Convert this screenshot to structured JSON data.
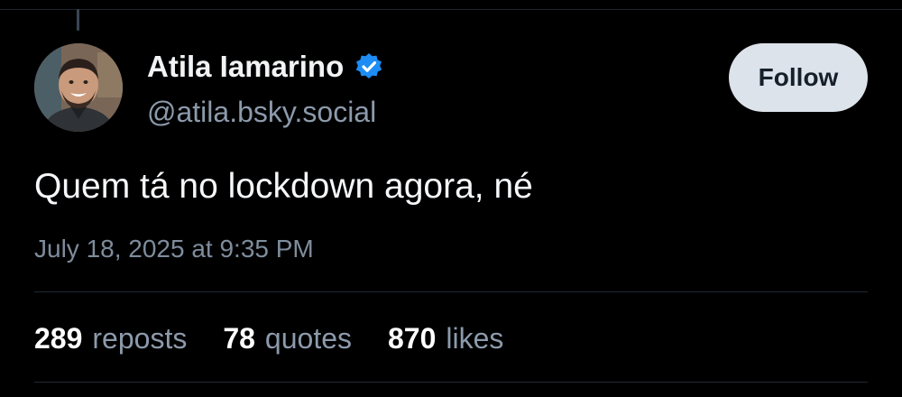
{
  "post": {
    "author": {
      "display_name": "Atila Iamarino",
      "handle": "@atila.bsky.social",
      "verified": true,
      "avatar": "profile-photo"
    },
    "follow_label": "Follow",
    "text": "Quem tá no lockdown agora, né",
    "timestamp": "July 18, 2025 at 9:35 PM",
    "stats": [
      {
        "count": "289",
        "label": "reposts"
      },
      {
        "count": "78",
        "label": "quotes"
      },
      {
        "count": "870",
        "label": "likes"
      }
    ]
  },
  "colors": {
    "background": "#000000",
    "text_primary": "#f1f3f5",
    "text_secondary": "#8c9aab",
    "verified_badge": "#1d8cf5",
    "follow_button_bg": "#dde3ea",
    "follow_button_text": "#15202b",
    "divider": "#1f2833"
  }
}
